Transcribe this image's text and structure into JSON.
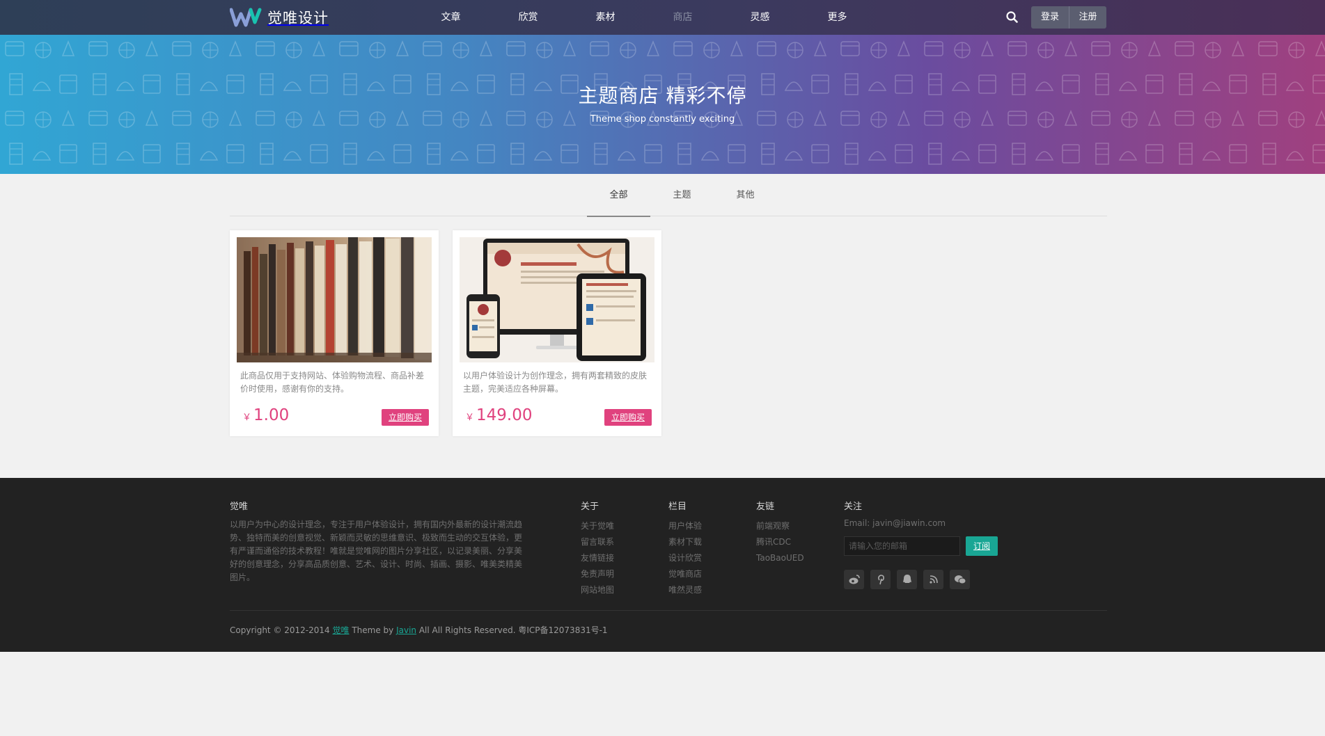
{
  "brand": {
    "name": "觉唯设计",
    "logo_colors": [
      "#8a9fd8",
      "#19c2b0"
    ]
  },
  "nav": {
    "items": [
      {
        "label": "文章",
        "active": false
      },
      {
        "label": "欣赏",
        "active": false
      },
      {
        "label": "素材",
        "active": false
      },
      {
        "label": "商店",
        "active": true
      },
      {
        "label": "灵感",
        "active": false
      },
      {
        "label": "更多",
        "active": false
      }
    ],
    "search_icon": "search-icon",
    "login_label": "登录",
    "register_label": "注册"
  },
  "banner": {
    "title": "主题商店 精彩不停",
    "subtitle": "Theme shop constantly exciting"
  },
  "tabs": [
    {
      "label": "全部",
      "active": true
    },
    {
      "label": "主题",
      "active": false
    },
    {
      "label": "其他",
      "active": false
    }
  ],
  "products": [
    {
      "image": "bookshelf-photo",
      "description": "此商品仅用于支持网站、体验购物流程、商品补差价时使用，感谢有你的支持。",
      "currency": "￥",
      "price": "1.00",
      "buy_label": "立即购买"
    },
    {
      "image": "responsive-devices-mockup",
      "description": "以用户体验设计为创作理念，拥有两套精致的皮肤主题，完美适应各种屏幕。",
      "currency": "￥",
      "price": "149.00",
      "buy_label": "立即购买"
    }
  ],
  "footer": {
    "about": {
      "title": "觉唯",
      "text": "以用户为中心的设计理念，专注于用户体验设计，拥有国内外最新的设计潮流趋势、独特而美的创意视觉、新颖而灵敏的思维意识、极致而生动的交互体验，更有严谨而通俗的技术教程！唯就是觉唯网的图片分享社区，以记录美丽、分享美好的创意理念，分享高品质创意、艺术、设计、时尚、插画、摄影、唯美类精美图片。"
    },
    "columns": [
      {
        "title": "关于",
        "links": [
          "关于觉唯",
          "留言联系",
          "友情链接",
          "免责声明",
          "网站地图"
        ]
      },
      {
        "title": "栏目",
        "links": [
          "用户体验",
          "素材下载",
          "设计欣赏",
          "觉唯商店",
          "唯然灵感"
        ]
      },
      {
        "title": "友链",
        "links": [
          "前端观察",
          "腾讯CDC",
          "TaoBaoUED"
        ]
      }
    ],
    "follow": {
      "title": "关注",
      "email": "Email: javin@jiawin.com",
      "input_placeholder": "请输入您的邮箱",
      "subscribe_label": "订阅",
      "social_icons": [
        "weibo-icon",
        "pinterest-icon",
        "qq-icon",
        "rss-icon",
        "wechat-icon"
      ]
    },
    "copyright": {
      "prefix": "Copyright © 2012-2014 ",
      "site": "觉唯",
      "middle": " Theme by ",
      "author": "Javin",
      "suffix": " All All Rights Reserved. 粤ICP备12073831号-1"
    }
  }
}
